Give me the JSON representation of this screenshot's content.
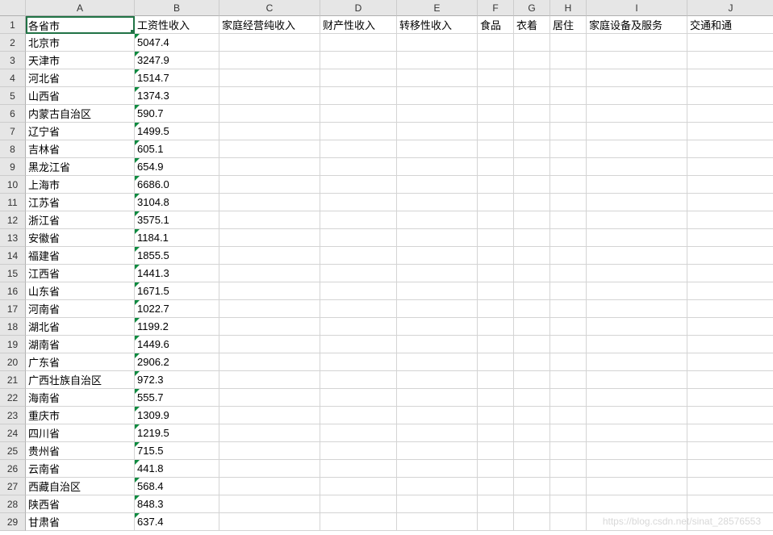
{
  "columns": [
    "A",
    "B",
    "C",
    "D",
    "E",
    "F",
    "G",
    "H",
    "I",
    "J"
  ],
  "headers": {
    "A": "各省市",
    "B": "工资性收入",
    "C": "家庭经营纯收入",
    "D": "财产性收入",
    "E": "转移性收入",
    "F": "食品",
    "G": "衣着",
    "H": "居住",
    "I": "家庭设备及服务",
    "J": "交通和通"
  },
  "rows": [
    {
      "n": "1",
      "A": "各省市",
      "B": "工资性收入"
    },
    {
      "n": "2",
      "A": "北京市",
      "B": "5047.4"
    },
    {
      "n": "3",
      "A": "天津市",
      "B": "3247.9"
    },
    {
      "n": "4",
      "A": "河北省",
      "B": "1514.7"
    },
    {
      "n": "5",
      "A": "山西省",
      "B": "1374.3"
    },
    {
      "n": "6",
      "A": "内蒙古自治区",
      "B": "590.7"
    },
    {
      "n": "7",
      "A": "辽宁省",
      "B": "1499.5"
    },
    {
      "n": "8",
      "A": "吉林省",
      "B": "605.1"
    },
    {
      "n": "9",
      "A": "黑龙江省",
      "B": "654.9"
    },
    {
      "n": "10",
      "A": "上海市",
      "B": "6686.0"
    },
    {
      "n": "11",
      "A": "江苏省",
      "B": "3104.8"
    },
    {
      "n": "12",
      "A": "浙江省",
      "B": "3575.1"
    },
    {
      "n": "13",
      "A": "安徽省",
      "B": "1184.1"
    },
    {
      "n": "14",
      "A": "福建省",
      "B": "1855.5"
    },
    {
      "n": "15",
      "A": "江西省",
      "B": "1441.3"
    },
    {
      "n": "16",
      "A": "山东省",
      "B": "1671.5"
    },
    {
      "n": "17",
      "A": "河南省",
      "B": "1022.7"
    },
    {
      "n": "18",
      "A": "湖北省",
      "B": "1199.2"
    },
    {
      "n": "19",
      "A": "湖南省",
      "B": "1449.6"
    },
    {
      "n": "20",
      "A": "广东省",
      "B": "2906.2"
    },
    {
      "n": "21",
      "A": "广西壮族自治区",
      "B": "972.3"
    },
    {
      "n": "22",
      "A": "海南省",
      "B": "555.7"
    },
    {
      "n": "23",
      "A": "重庆市",
      "B": "1309.9"
    },
    {
      "n": "24",
      "A": "四川省",
      "B": "1219.5"
    },
    {
      "n": "25",
      "A": "贵州省",
      "B": "715.5"
    },
    {
      "n": "26",
      "A": "云南省",
      "B": "441.8"
    },
    {
      "n": "27",
      "A": "西藏自治区",
      "B": "568.4"
    },
    {
      "n": "28",
      "A": "陕西省",
      "B": "848.3"
    },
    {
      "n": "29",
      "A": "甘肃省",
      "B": "637.4"
    }
  ],
  "selected": {
    "row": 1,
    "col": "A"
  },
  "watermark": "https://blog.csdn.net/sinat_28576553"
}
